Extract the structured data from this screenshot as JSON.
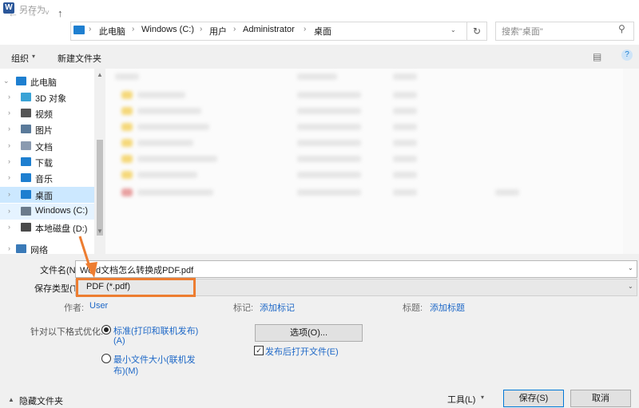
{
  "window": {
    "title": "另存为",
    "app_icon": "W"
  },
  "nav": {
    "back_icon": "←",
    "forward_icon": "→",
    "recent_icon": "˅",
    "up_icon": "↑",
    "breadcrumbs": [
      "此电脑",
      "Windows (C:)",
      "用户",
      "Administrator",
      "桌面"
    ],
    "refresh_icon": "↻",
    "search_placeholder": "搜索\"桌面\"",
    "search_icon": "⚲"
  },
  "toolbar": {
    "organize_label": "组织",
    "organize_arrow": "▾",
    "new_folder_label": "新建文件夹",
    "view_icon": "▤",
    "help_icon": "?"
  },
  "tree": {
    "items": [
      {
        "label": "此电脑",
        "icon": "pc",
        "color": "#1e7fd0",
        "chevron": "⌄",
        "state": ""
      },
      {
        "label": "3D 对象",
        "icon": "cube",
        "color": "#3aa3d6",
        "chevron": "›",
        "state": ""
      },
      {
        "label": "视频",
        "icon": "video",
        "color": "#555555",
        "chevron": "›",
        "state": ""
      },
      {
        "label": "图片",
        "icon": "pictures",
        "color": "#5a7a9a",
        "chevron": "›",
        "state": ""
      },
      {
        "label": "文档",
        "icon": "documents",
        "color": "#8a9ab0",
        "chevron": "›",
        "state": ""
      },
      {
        "label": "下载",
        "icon": "download",
        "color": "#1e7fd0",
        "chevron": "›",
        "state": ""
      },
      {
        "label": "音乐",
        "icon": "music",
        "color": "#1e7fd0",
        "chevron": "›",
        "state": ""
      },
      {
        "label": "桌面",
        "icon": "desktop",
        "color": "#1e7fd0",
        "chevron": "›",
        "state": "selected"
      },
      {
        "label": "Windows (C:)",
        "icon": "drive-c",
        "color": "#6b7b8b",
        "chevron": "›",
        "state": "hover"
      },
      {
        "label": "本地磁盘 (D:)",
        "icon": "drive-d",
        "color": "#4a4a4a",
        "chevron": "›",
        "state": ""
      },
      {
        "label": "网络",
        "icon": "network",
        "color": "#3a7ab8",
        "chevron": "›",
        "state": ""
      }
    ]
  },
  "form": {
    "filename_label": "文件名(N):",
    "filename_value": "Word文档怎么转换成PDF.pdf",
    "filetype_label": "保存类型(T):",
    "filetype_value": "PDF (*.pdf)",
    "author_label": "作者:",
    "author_value": "User",
    "tags_label": "标记:",
    "tags_value": "添加标记",
    "title_label": "标题:",
    "title_value": "添加标题",
    "optimize_label": "针对以下格式优化:",
    "radio_standard": "标准(打印和联机发布)",
    "radio_standard_key": "(A)",
    "radio_min": "最小文件大小(联机发",
    "radio_min_key": "布)(M)",
    "options_button": "选项(O)...",
    "open_after_label": "发布后打开文件(E)",
    "open_after_checked": true
  },
  "footer": {
    "hide_folders_label": "隐藏文件夹",
    "hide_folders_icon": "▲",
    "tools_label": "工具(L)",
    "tools_arrow": "▾",
    "save_button": "保存(S)",
    "cancel_button": "取消"
  },
  "colors": {
    "accent": "#1e68c7",
    "highlight": "#ed7d31",
    "selection": "#cce8ff"
  }
}
